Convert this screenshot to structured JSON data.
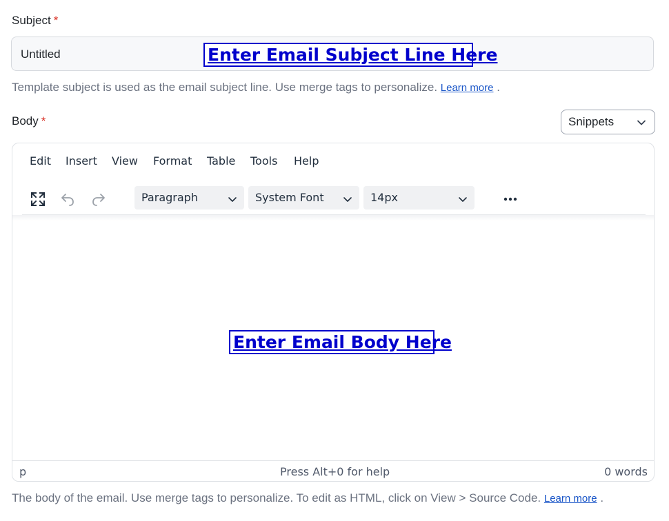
{
  "subject": {
    "label": "Subject",
    "required_mark": "*",
    "value": "Untitled",
    "overlay_text": "Enter Email Subject Line Here",
    "help_text": "Template subject is used as the email subject line. Use merge tags to personalize.",
    "learn_more": "Learn more",
    "help_suffix": "."
  },
  "body": {
    "label": "Body",
    "required_mark": "*",
    "snippets_label": "Snippets",
    "overlay_text": "Enter Email Body Here",
    "help_text": "The body of the email. Use merge tags to personalize. To edit as HTML, click on View > Source Code.",
    "learn_more": "Learn more",
    "help_suffix": "."
  },
  "editor": {
    "menu": [
      "Edit",
      "Insert",
      "View",
      "Format",
      "Table",
      "Tools",
      "Help"
    ],
    "toolbar": {
      "icons": [
        "fullscreen-icon",
        "undo-icon",
        "redo-icon",
        "more-icon"
      ],
      "block_format": "Paragraph",
      "font_family": "System Font",
      "font_size": "14px"
    },
    "status": {
      "path": "p",
      "help": "Press Alt+0 for help",
      "word_count": "0 words"
    }
  },
  "colors": {
    "required": "#d93025",
    "link": "#1a56c8",
    "overlay": "#0000cc"
  }
}
